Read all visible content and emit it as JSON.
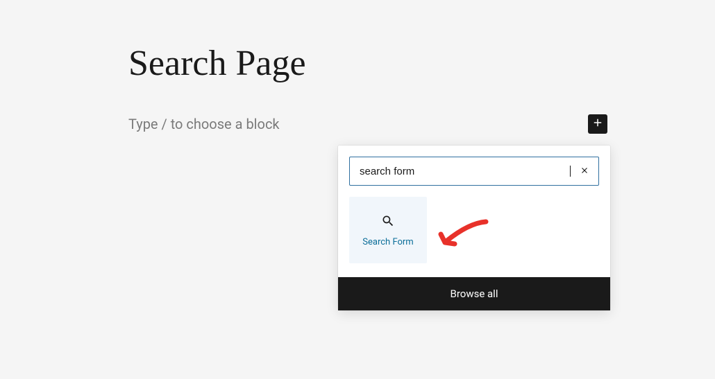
{
  "page": {
    "title": "Search Page",
    "block_placeholder": "Type / to choose a block"
  },
  "inserter": {
    "search_value": "search form",
    "results": [
      {
        "label": "Search Form",
        "icon": "search-icon"
      }
    ],
    "browse_all_label": "Browse all"
  },
  "colors": {
    "accent": "#2f6f9f",
    "link": "#0b6e99",
    "annotation": "#e8312a"
  }
}
